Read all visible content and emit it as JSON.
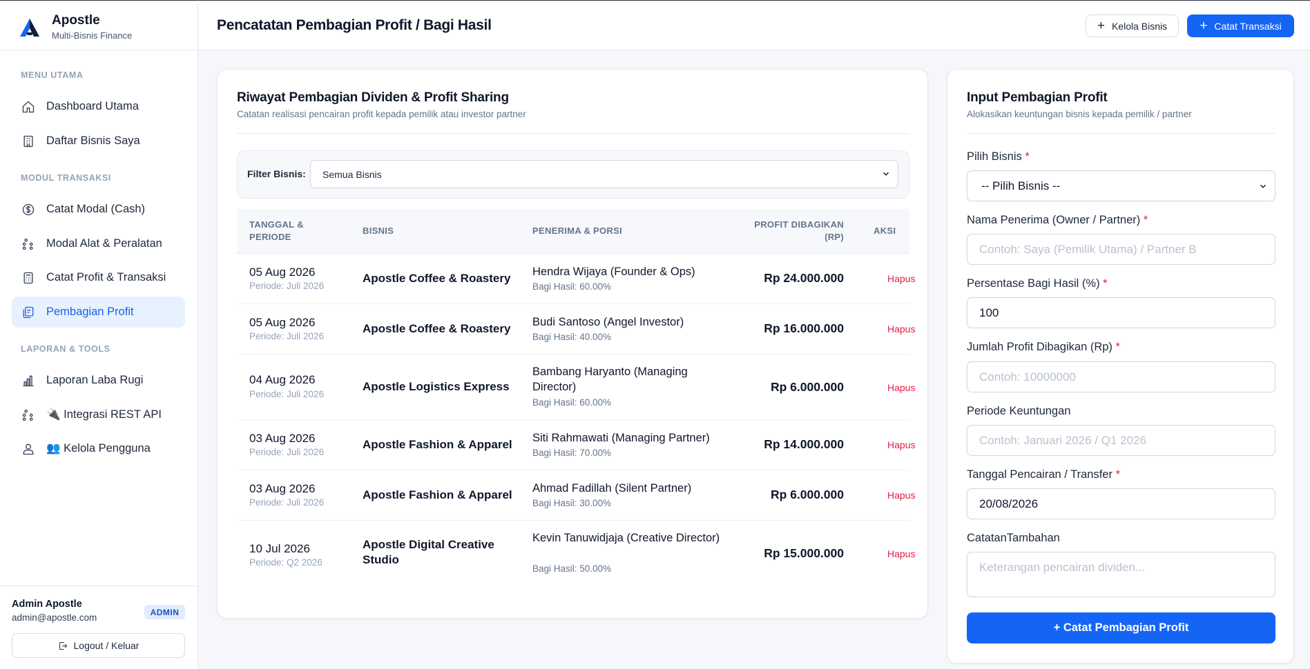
{
  "app": {
    "name": "Apostle",
    "subtitle": "Multi-Bisnis Finance"
  },
  "sidebar": {
    "sections": [
      {
        "label": "MENU UTAMA"
      },
      {
        "label": "MODUL TRANSAKSI"
      },
      {
        "label": "LAPORAN & TOOLS"
      }
    ],
    "items": [
      {
        "label": "Dashboard Utama",
        "icon": "home-icon"
      },
      {
        "label": "Daftar Bisnis Saya",
        "icon": "building-icon"
      },
      {
        "label": "Catat Modal (Cash)",
        "icon": "dollar-circle-icon"
      },
      {
        "label": "Modal Alat & Peralatan",
        "icon": "network-icon"
      },
      {
        "label": "Catat Profit & Transaksi",
        "icon": "calculator-icon"
      },
      {
        "label": "Pembagian Profit",
        "icon": "receipt-icon",
        "active": true
      },
      {
        "label": "Laporan Laba Rugi",
        "icon": "bar-chart-icon"
      },
      {
        "label": "🔌 Integrasi REST API",
        "icon": "network-icon"
      },
      {
        "label": "👥 Kelola Pengguna",
        "icon": "users-icon"
      }
    ],
    "user": {
      "name": "Admin Apostle",
      "email": "admin@apostle.com",
      "role": "ADMIN"
    },
    "logout_label": "Logout / Keluar"
  },
  "header": {
    "title": "Pencatatan Pembagian Profit / Bagi Hasil",
    "manage_business_label": "Kelola Bisnis",
    "record_transaction_label": "Catat Transaksi"
  },
  "history": {
    "title": "Riwayat Pembagian Dividen & Profit Sharing",
    "subtitle": "Catatan realisasi pencairan profit kepada pemilik atau investor partner",
    "filter": {
      "label": "Filter Bisnis:",
      "selected": "Semua Bisnis"
    },
    "columns": {
      "date": "TANGGAL & PERIODE",
      "business": "BISNIS",
      "recipient": "PENERIMA & PORSI",
      "amount": "PROFIT DIBAGIKAN (RP)",
      "action": "AKSI"
    },
    "rows": [
      {
        "date": "05 Aug 2026",
        "period": "Periode: Juli 2026",
        "business": "Apostle Coffee & Roastery",
        "recipient": "Hendra Wijaya (Founder & Ops)",
        "share": "Bagi Hasil: 60.00%",
        "amount": "Rp 24.000.000",
        "action": "Hapus"
      },
      {
        "date": "05 Aug 2026",
        "period": "Periode: Juli 2026",
        "business": "Apostle Coffee & Roastery",
        "recipient": "Budi Santoso (Angel Investor)",
        "share": "Bagi Hasil: 40.00%",
        "amount": "Rp 16.000.000",
        "action": "Hapus"
      },
      {
        "date": "04 Aug 2026",
        "period": "Periode: Juli 2026",
        "business": "Apostle Logistics Express",
        "recipient": "Bambang Haryanto (Managing Director)",
        "share": "Bagi Hasil: 60.00%",
        "amount": "Rp 6.000.000",
        "action": "Hapus"
      },
      {
        "date": "03 Aug 2026",
        "period": "Periode: Juli 2026",
        "business": "Apostle Fashion & Apparel",
        "recipient": "Siti Rahmawati (Managing Partner)",
        "share": "Bagi Hasil: 70.00%",
        "amount": "Rp 14.000.000",
        "action": "Hapus"
      },
      {
        "date": "03 Aug 2026",
        "period": "Periode: Juli 2026",
        "business": "Apostle Fashion & Apparel",
        "recipient": "Ahmad Fadillah (Silent Partner)",
        "share": "Bagi Hasil: 30.00%",
        "amount": "Rp 6.000.000",
        "action": "Hapus"
      },
      {
        "date": "10 Jul 2026",
        "period": "Periode: Q2 2026",
        "business": "Apostle Digital Creative Studio",
        "recipient": "Kevin Tanuwidjaja (Creative Director)",
        "share": "Bagi Hasil: 50.00%",
        "amount": "Rp 15.000.000",
        "action": "Hapus"
      }
    ]
  },
  "form": {
    "title": "Input Pembagian Profit",
    "subtitle": "Alokasikan keuntungan bisnis kepada pemilik / partner",
    "business_label": "Pilih Bisnis",
    "business_selected": "-- Pilih Bisnis --",
    "recipient_label": "Nama Penerima (Owner / Partner)",
    "recipient_placeholder": "Contoh: Saya (Pemilik Utama) / Partner B",
    "percent_label": "Persentase Bagi Hasil (%)",
    "percent_value": "100",
    "amount_label": "Jumlah Profit Dibagikan (Rp)",
    "amount_placeholder": "Contoh: 10000000",
    "period_label": "Periode Keuntungan",
    "period_placeholder": "Contoh: Januari 2026 / Q1 2026",
    "date_label": "Tanggal Pencairan / Transfer",
    "date_value": "20/08/2026",
    "notes_label": "CatatanTambahan",
    "notes_placeholder": "Keterangan pencairan dividen...",
    "required_mark": "*",
    "submit_label": "+ Catat Pembagian Profit"
  },
  "colors": {
    "accent": "#1565f5",
    "danger": "#e11d48",
    "active_bg": "#e8f1fe"
  }
}
